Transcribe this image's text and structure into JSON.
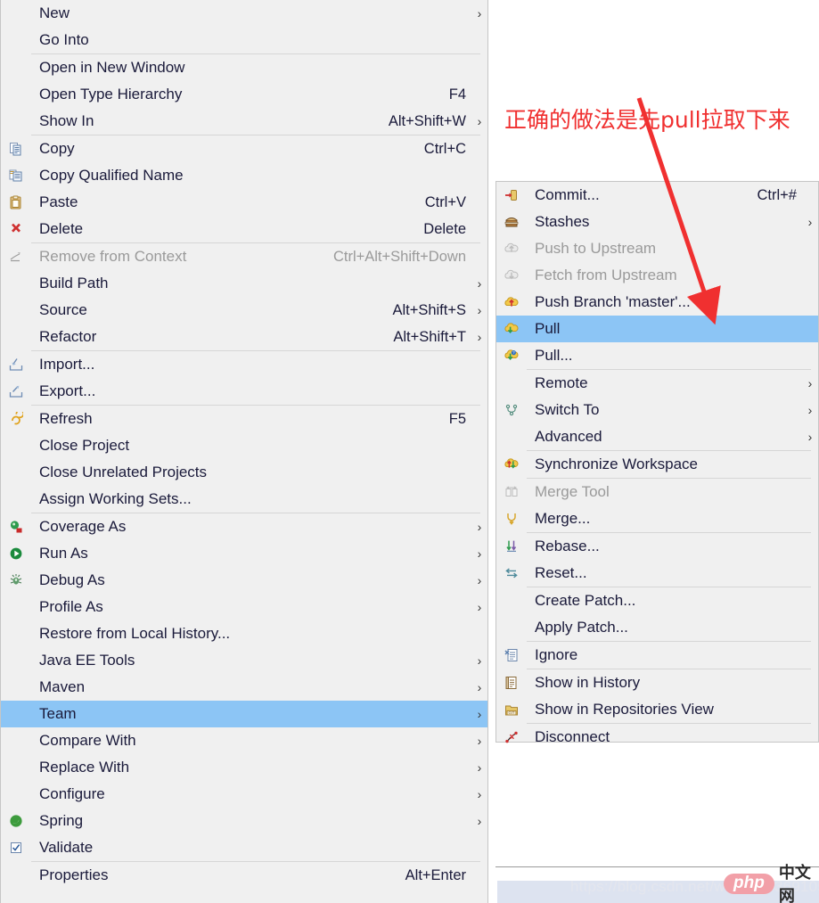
{
  "app": {
    "kind": "eclipse-context-menu",
    "highlight_color": "#8CC5F5",
    "menu_background": "#F0F0F0",
    "annotation_color": "#F03030"
  },
  "annotation": {
    "text": "正确的做法是先pull拉取下来"
  },
  "context_menu": {
    "groups": [
      {
        "items": [
          {
            "label": "New",
            "accel": "",
            "icon": "",
            "submenu": true,
            "disabled": false
          },
          {
            "label": "Go Into",
            "accel": "",
            "icon": "",
            "submenu": false,
            "disabled": false
          }
        ]
      },
      {
        "items": [
          {
            "label": "Open in New Window",
            "accel": "",
            "icon": "",
            "submenu": false,
            "disabled": false
          },
          {
            "label": "Open Type Hierarchy",
            "accel": "F4",
            "icon": "",
            "submenu": false,
            "disabled": false
          },
          {
            "label": "Show In",
            "accel": "Alt+Shift+W",
            "icon": "",
            "submenu": true,
            "disabled": false
          }
        ]
      },
      {
        "items": [
          {
            "label": "Copy",
            "accel": "Ctrl+C",
            "icon": "copy-icon",
            "submenu": false,
            "disabled": false
          },
          {
            "label": "Copy Qualified Name",
            "accel": "",
            "icon": "copy-qualified-icon",
            "submenu": false,
            "disabled": false
          },
          {
            "label": "Paste",
            "accel": "Ctrl+V",
            "icon": "paste-icon",
            "submenu": false,
            "disabled": false
          },
          {
            "label": "Delete",
            "accel": "Delete",
            "icon": "delete-x-icon",
            "submenu": false,
            "disabled": false
          }
        ]
      },
      {
        "items": [
          {
            "label": "Remove from Context",
            "accel": "Ctrl+Alt+Shift+Down",
            "icon": "remove-context-icon",
            "submenu": false,
            "disabled": true
          },
          {
            "label": "Build Path",
            "accel": "",
            "icon": "",
            "submenu": true,
            "disabled": false
          },
          {
            "label": "Source",
            "accel": "Alt+Shift+S",
            "icon": "",
            "submenu": true,
            "disabled": false
          },
          {
            "label": "Refactor",
            "accel": "Alt+Shift+T",
            "icon": "",
            "submenu": true,
            "disabled": false
          }
        ]
      },
      {
        "items": [
          {
            "label": "Import...",
            "accel": "",
            "icon": "import-icon",
            "submenu": false,
            "disabled": false
          },
          {
            "label": "Export...",
            "accel": "",
            "icon": "export-icon",
            "submenu": false,
            "disabled": false
          }
        ]
      },
      {
        "items": [
          {
            "label": "Refresh",
            "accel": "F5",
            "icon": "refresh-icon",
            "submenu": false,
            "disabled": false
          },
          {
            "label": "Close Project",
            "accel": "",
            "icon": "",
            "submenu": false,
            "disabled": false
          },
          {
            "label": "Close Unrelated Projects",
            "accel": "",
            "icon": "",
            "submenu": false,
            "disabled": false
          },
          {
            "label": "Assign Working Sets...",
            "accel": "",
            "icon": "",
            "submenu": false,
            "disabled": false
          }
        ]
      },
      {
        "items": [
          {
            "label": "Coverage As",
            "accel": "",
            "icon": "coverage-icon",
            "submenu": true,
            "disabled": false
          },
          {
            "label": "Run As",
            "accel": "",
            "icon": "run-icon",
            "submenu": true,
            "disabled": false
          },
          {
            "label": "Debug As",
            "accel": "",
            "icon": "debug-icon",
            "submenu": true,
            "disabled": false
          },
          {
            "label": "Profile As",
            "accel": "",
            "icon": "",
            "submenu": true,
            "disabled": false
          },
          {
            "label": "Restore from Local History...",
            "accel": "",
            "icon": "",
            "submenu": false,
            "disabled": false
          },
          {
            "label": "Java EE Tools",
            "accel": "",
            "icon": "",
            "submenu": true,
            "disabled": false
          },
          {
            "label": "Maven",
            "accel": "",
            "icon": "",
            "submenu": true,
            "disabled": false
          },
          {
            "label": "Team",
            "accel": "",
            "icon": "",
            "submenu": true,
            "disabled": false,
            "selected": true
          },
          {
            "label": "Compare With",
            "accel": "",
            "icon": "",
            "submenu": true,
            "disabled": false
          },
          {
            "label": "Replace With",
            "accel": "",
            "icon": "",
            "submenu": true,
            "disabled": false
          },
          {
            "label": "Configure",
            "accel": "",
            "icon": "",
            "submenu": true,
            "disabled": false
          },
          {
            "label": "Spring",
            "accel": "",
            "icon": "spring-icon",
            "submenu": true,
            "disabled": false
          },
          {
            "label": "Validate",
            "accel": "",
            "icon": "validate-check-icon",
            "submenu": false,
            "disabled": false
          }
        ]
      },
      {
        "items": [
          {
            "label": "Properties",
            "accel": "Alt+Enter",
            "icon": "",
            "submenu": false,
            "disabled": false
          }
        ]
      }
    ]
  },
  "team_submenu": {
    "groups": [
      {
        "items": [
          {
            "label": "Commit...",
            "accel": "Ctrl+#",
            "icon": "commit-icon",
            "submenu": false,
            "disabled": false
          },
          {
            "label": "Stashes",
            "accel": "",
            "icon": "stashes-icon",
            "submenu": true,
            "disabled": false
          },
          {
            "label": "Push to Upstream",
            "accel": "",
            "icon": "push-upstream-icon",
            "submenu": false,
            "disabled": true
          },
          {
            "label": "Fetch from Upstream",
            "accel": "",
            "icon": "fetch-upstream-icon",
            "submenu": false,
            "disabled": true
          },
          {
            "label": "Push Branch 'master'...",
            "accel": "",
            "icon": "push-branch-icon",
            "submenu": false,
            "disabled": false
          },
          {
            "label": "Pull",
            "accel": "",
            "icon": "pull-icon",
            "submenu": false,
            "disabled": false,
            "selected": true
          },
          {
            "label": "Pull...",
            "accel": "",
            "icon": "pull-dialog-icon",
            "submenu": false,
            "disabled": false
          }
        ]
      },
      {
        "items": [
          {
            "label": "Remote",
            "accel": "",
            "icon": "",
            "submenu": true,
            "disabled": false
          },
          {
            "label": "Switch To",
            "accel": "",
            "icon": "switch-to-icon",
            "submenu": true,
            "disabled": false
          },
          {
            "label": "Advanced",
            "accel": "",
            "icon": "",
            "submenu": true,
            "disabled": false
          }
        ]
      },
      {
        "items": [
          {
            "label": "Synchronize Workspace",
            "accel": "",
            "icon": "synchronize-icon",
            "submenu": false,
            "disabled": false
          }
        ]
      },
      {
        "items": [
          {
            "label": "Merge Tool",
            "accel": "",
            "icon": "merge-tool-icon",
            "submenu": false,
            "disabled": true
          },
          {
            "label": "Merge...",
            "accel": "",
            "icon": "merge-icon",
            "submenu": false,
            "disabled": false
          }
        ]
      },
      {
        "items": [
          {
            "label": "Rebase...",
            "accel": "",
            "icon": "rebase-icon",
            "submenu": false,
            "disabled": false
          },
          {
            "label": "Reset...",
            "accel": "",
            "icon": "reset-icon",
            "submenu": false,
            "disabled": false
          }
        ]
      },
      {
        "items": [
          {
            "label": "Create Patch...",
            "accel": "",
            "icon": "",
            "submenu": false,
            "disabled": false
          },
          {
            "label": "Apply Patch...",
            "accel": "",
            "icon": "",
            "submenu": false,
            "disabled": false
          }
        ]
      },
      {
        "items": [
          {
            "label": "Ignore",
            "accel": "",
            "icon": "ignore-icon",
            "submenu": false,
            "disabled": false
          }
        ]
      },
      {
        "items": [
          {
            "label": "Show in History",
            "accel": "",
            "icon": "history-icon",
            "submenu": false,
            "disabled": false
          },
          {
            "label": "Show in Repositories View",
            "accel": "",
            "icon": "repositories-icon",
            "submenu": false,
            "disabled": false
          }
        ]
      },
      {
        "items": [
          {
            "label": "Disconnect",
            "accel": "",
            "icon": "disconnect-icon",
            "submenu": false,
            "disabled": false
          }
        ]
      }
    ]
  },
  "watermark": {
    "url": "https://blog.csdn.net/weixin_43691058",
    "logo_text": "php",
    "logo_cn": "中文网"
  }
}
